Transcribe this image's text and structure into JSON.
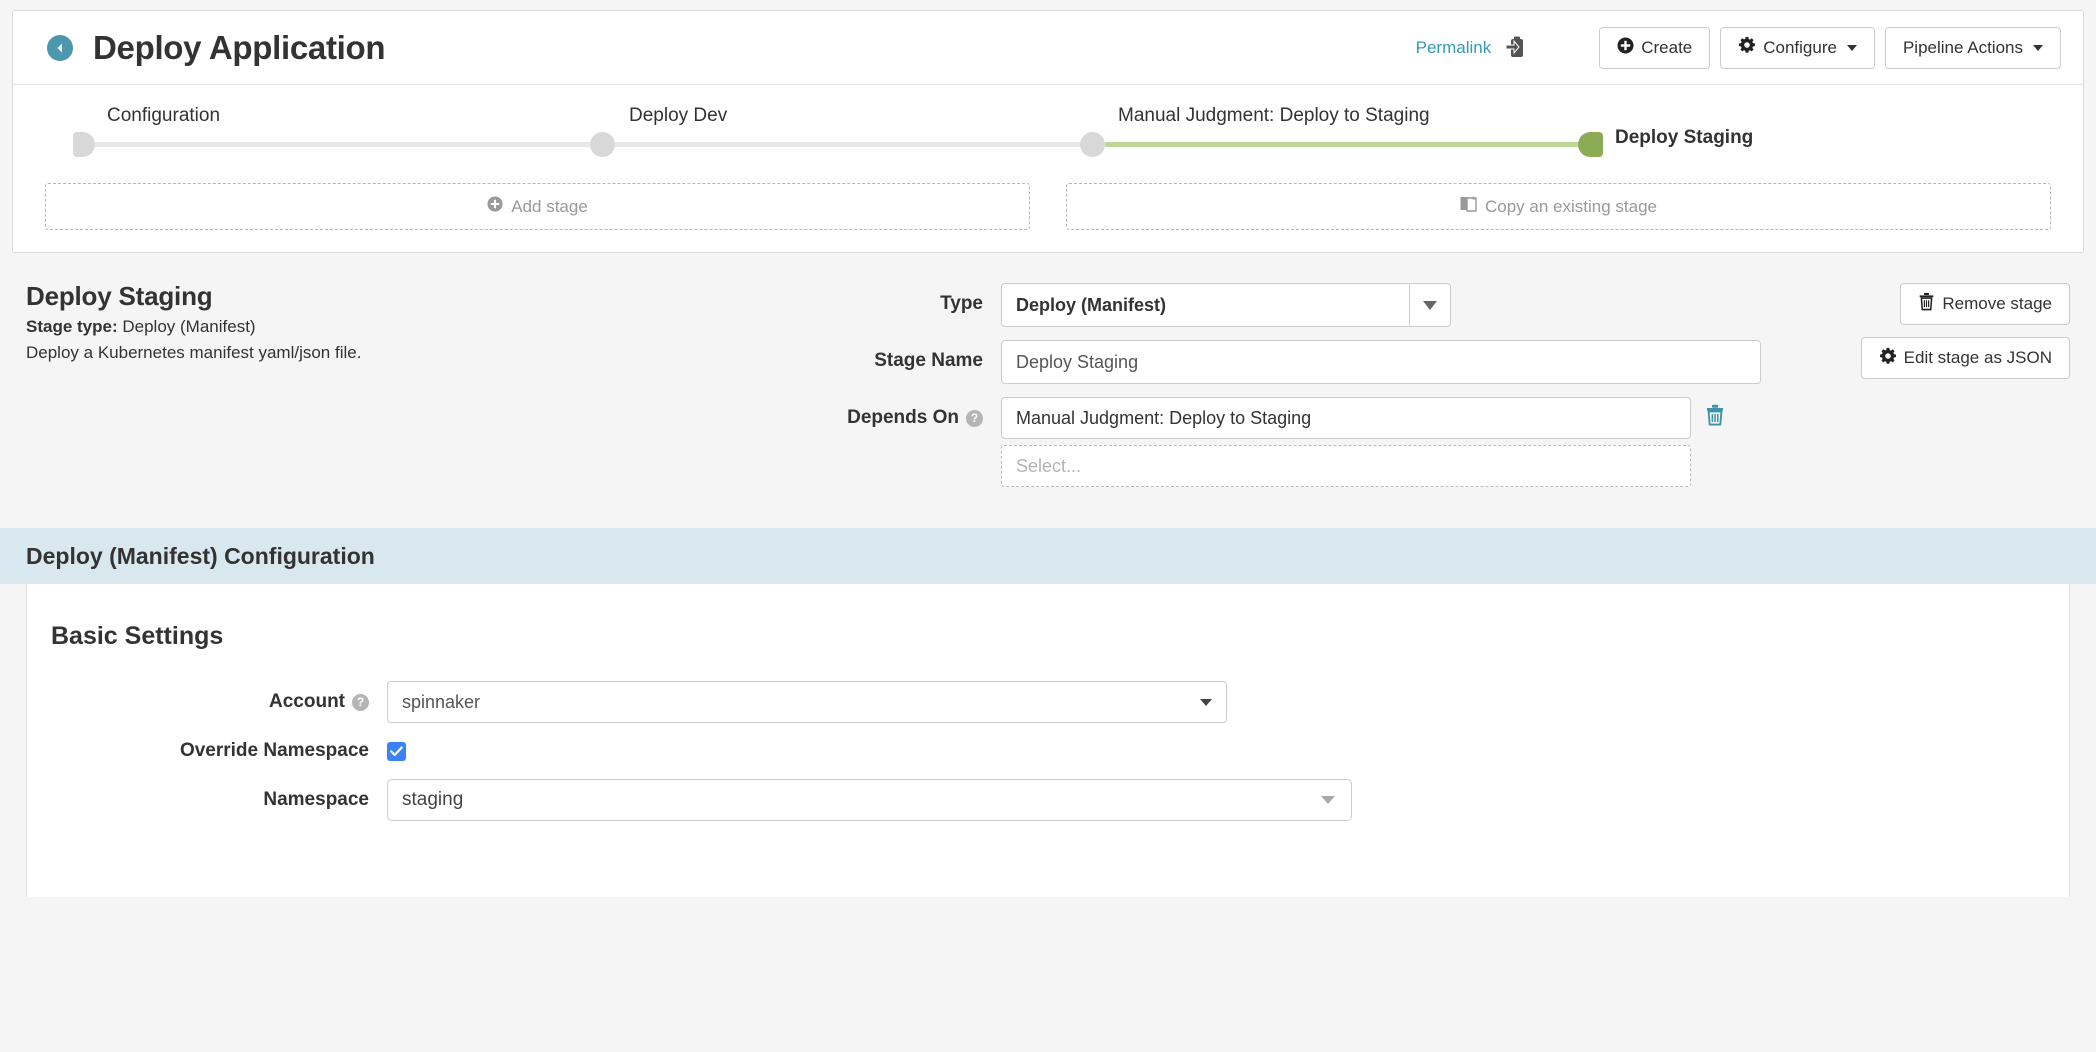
{
  "header": {
    "back_icon": "back-arrow-circle-icon",
    "title": "Deploy Application",
    "permalink_label": "Permalink",
    "clipboard_icon": "clipboard-copy-icon",
    "buttons": [
      {
        "label": "Create",
        "icon": "plus-circle-icon",
        "caret": false
      },
      {
        "label": "Configure",
        "icon": "gear-icon",
        "caret": true
      },
      {
        "label": "Pipeline Actions",
        "icon": "",
        "caret": true
      }
    ]
  },
  "graph": {
    "nodes": [
      {
        "label": "Configuration",
        "state": "inactive"
      },
      {
        "label": "Deploy Dev",
        "state": "inactive"
      },
      {
        "label": "Manual Judgment: Deploy to Staging",
        "state": "inactive"
      },
      {
        "label": "Deploy Staging",
        "state": "active"
      }
    ],
    "active_color": "#bed698",
    "inactive_color": "#e8e8e8",
    "add_stage_label": "Add stage",
    "add_stage_icon": "plus-circle-icon",
    "copy_stage_label": "Copy an existing stage",
    "copy_stage_icon": "copy-file-icon"
  },
  "stage": {
    "name": "Deploy Staging",
    "stage_type_label": "Stage type:",
    "stage_type_value": "Deploy (Manifest)",
    "description": "Deploy a Kubernetes manifest yaml/json file.",
    "form": {
      "type_label": "Type",
      "type_value": "Deploy (Manifest)",
      "stage_name_label": "Stage Name",
      "stage_name_value": "Deploy Staging",
      "depends_on_label": "Depends On",
      "depends_on_help": "?",
      "depends_on_value": "Manual Judgment: Deploy to Staging",
      "depends_on_placeholder": "Select...",
      "delete_depends_icon": "trash-icon"
    },
    "actions": [
      {
        "label": "Remove stage",
        "icon": "trash-icon"
      },
      {
        "label": "Edit stage as JSON",
        "icon": "gear-icon"
      }
    ]
  },
  "config": {
    "band_title": "Deploy (Manifest) Configuration",
    "band_color": "#d9e7ee",
    "basic_settings_title": "Basic Settings",
    "account_label": "Account",
    "account_help": "?",
    "account_value": "spinnaker",
    "override_namespace_label": "Override Namespace",
    "override_namespace_checked": true,
    "checkbox_color": "#3b82f6",
    "namespace_label": "Namespace",
    "namespace_value": "staging"
  }
}
